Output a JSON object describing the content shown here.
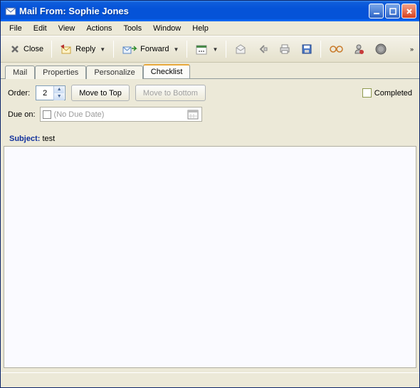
{
  "window": {
    "title": "Mail From: Sophie Jones"
  },
  "menus": {
    "file": "File",
    "edit": "Edit",
    "view": "View",
    "actions": "Actions",
    "tools": "Tools",
    "window": "Window",
    "help": "Help"
  },
  "toolbar": {
    "close": "Close",
    "reply": "Reply",
    "forward": "Forward"
  },
  "tabs": {
    "mail": "Mail",
    "properties": "Properties",
    "personalize": "Personalize",
    "checklist": "Checklist"
  },
  "checklist": {
    "order_label": "Order:",
    "order_value": "2",
    "move_top": "Move to Top",
    "move_bottom": "Move to Bottom",
    "completed_label": "Completed",
    "due_label": "Due on:",
    "due_placeholder": "(No Due Date)"
  },
  "subject": {
    "label": "Subject:",
    "value": "test"
  }
}
